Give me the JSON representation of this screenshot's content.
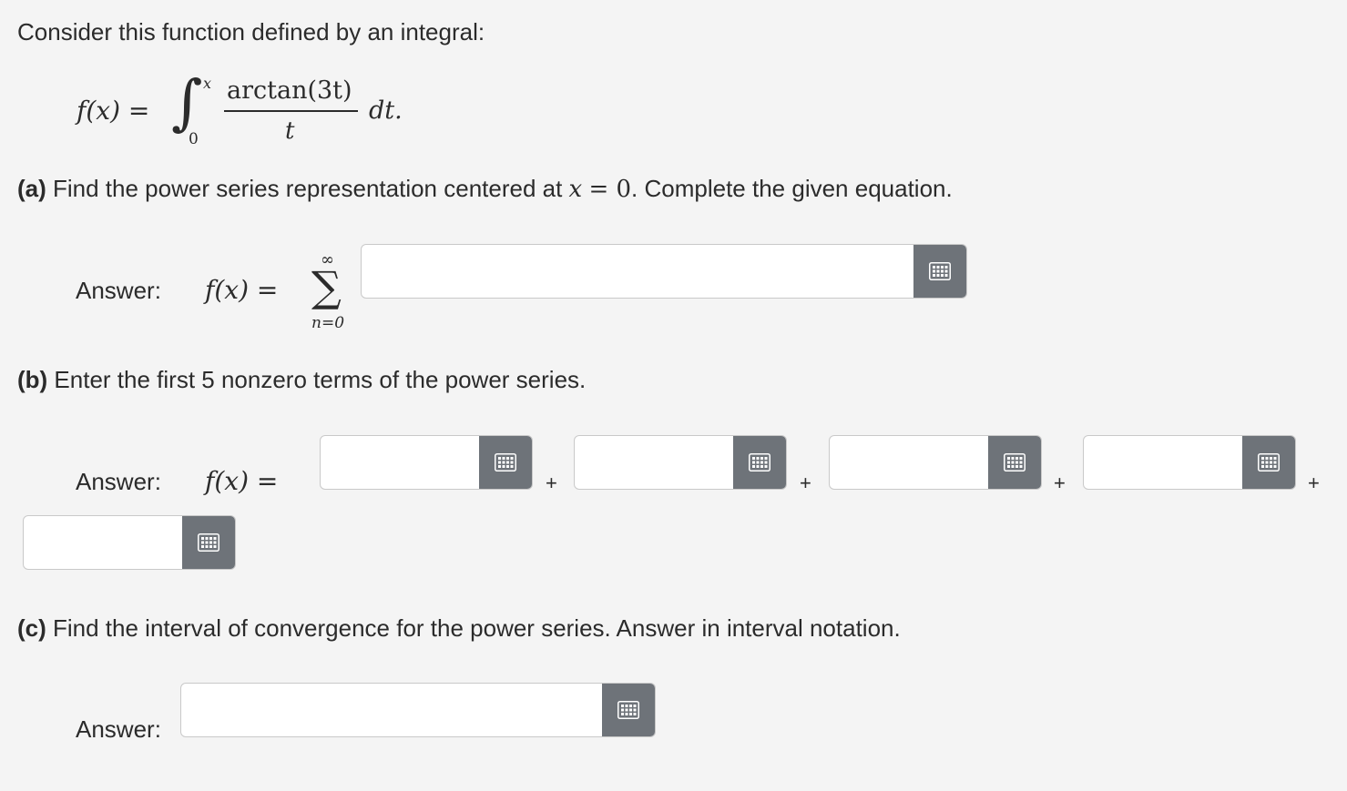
{
  "intro": "Consider this function defined by an integral:",
  "integral": {
    "lhs": "f(x) =",
    "integral_sign": "∫",
    "upper_limit": "x",
    "lower_limit": "0",
    "numerator": "arctan(3t)",
    "denominator": "t",
    "differential": "dt."
  },
  "part_a": {
    "label": "(a)",
    "text_before": " Find the power series representation centered at ",
    "math_x": "x",
    "math_eq": "= 0",
    "text_after": ". Complete the given equation.",
    "answer_label": "Answer:",
    "lhs": "f(x) =",
    "sum_upper": "∞",
    "sum_symbol": "∑",
    "sum_lower": "n=0",
    "input_value": ""
  },
  "part_b": {
    "label": "(b)",
    "text": " Enter the first 5 nonzero terms of the power series.",
    "answer_label": "Answer:",
    "lhs": "f(x) =",
    "plus": "+",
    "term_values": [
      "",
      "",
      "",
      "",
      ""
    ]
  },
  "part_c": {
    "label": "(c)",
    "text": " Find the interval of convergence for the power series. Answer in interval notation.",
    "answer_label": "Answer:",
    "input_value": ""
  },
  "icons": {
    "keyboard": "keypad-grid-icon"
  },
  "colors": {
    "keypad_button": "#6e7379",
    "background": "#f4f4f4"
  }
}
